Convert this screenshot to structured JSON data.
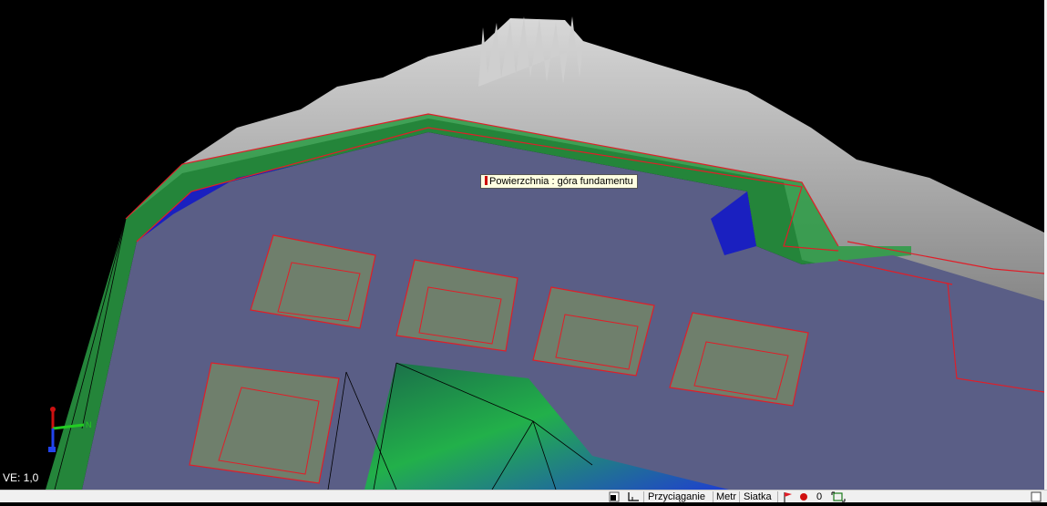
{
  "viewport": {
    "tooltip": "Powierzchnia : góra fundamentu",
    "vertical_exaggeration": "VE: 1,0"
  },
  "statusbar": {
    "snap": "Przyciąganie",
    "units": "Metr",
    "grid": "Siatka",
    "counter": "0"
  },
  "colors": {
    "background": "#000000",
    "ground": "#5a5e86",
    "water": "#1a20c0",
    "slope": "#27a03c",
    "outline": "#e01e28",
    "terrain": "#8c8c8c"
  }
}
